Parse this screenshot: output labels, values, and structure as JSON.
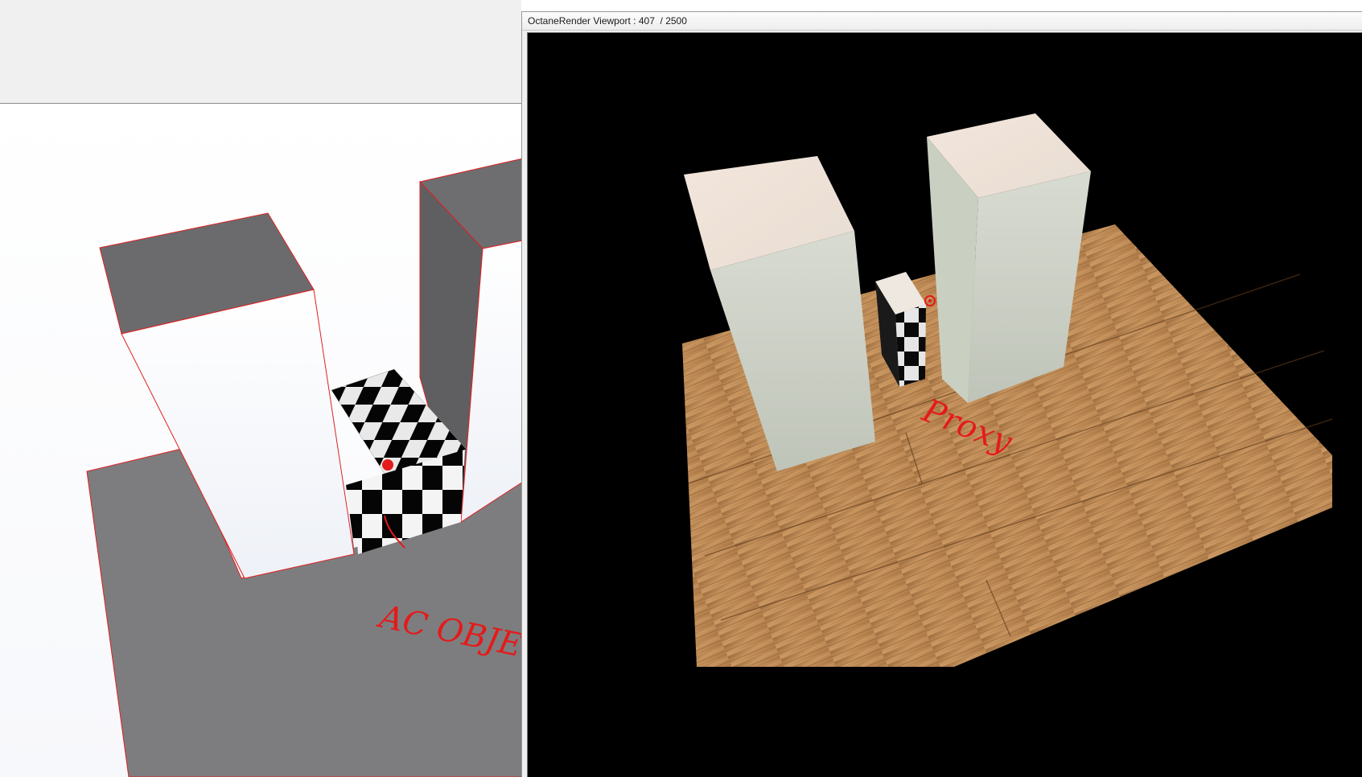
{
  "octane_window": {
    "title": "OctaneRender Viewport : 407  / 2500",
    "samples_current": 407,
    "samples_total": 2500
  },
  "annotations": {
    "model_label": "AC OBJECT",
    "render_label": "Proxy"
  },
  "colors": {
    "annotation_red": "#e51a1a",
    "render_background": "#000000",
    "model_face_gray": "#6b6b6e",
    "wood": "#b9824a"
  }
}
